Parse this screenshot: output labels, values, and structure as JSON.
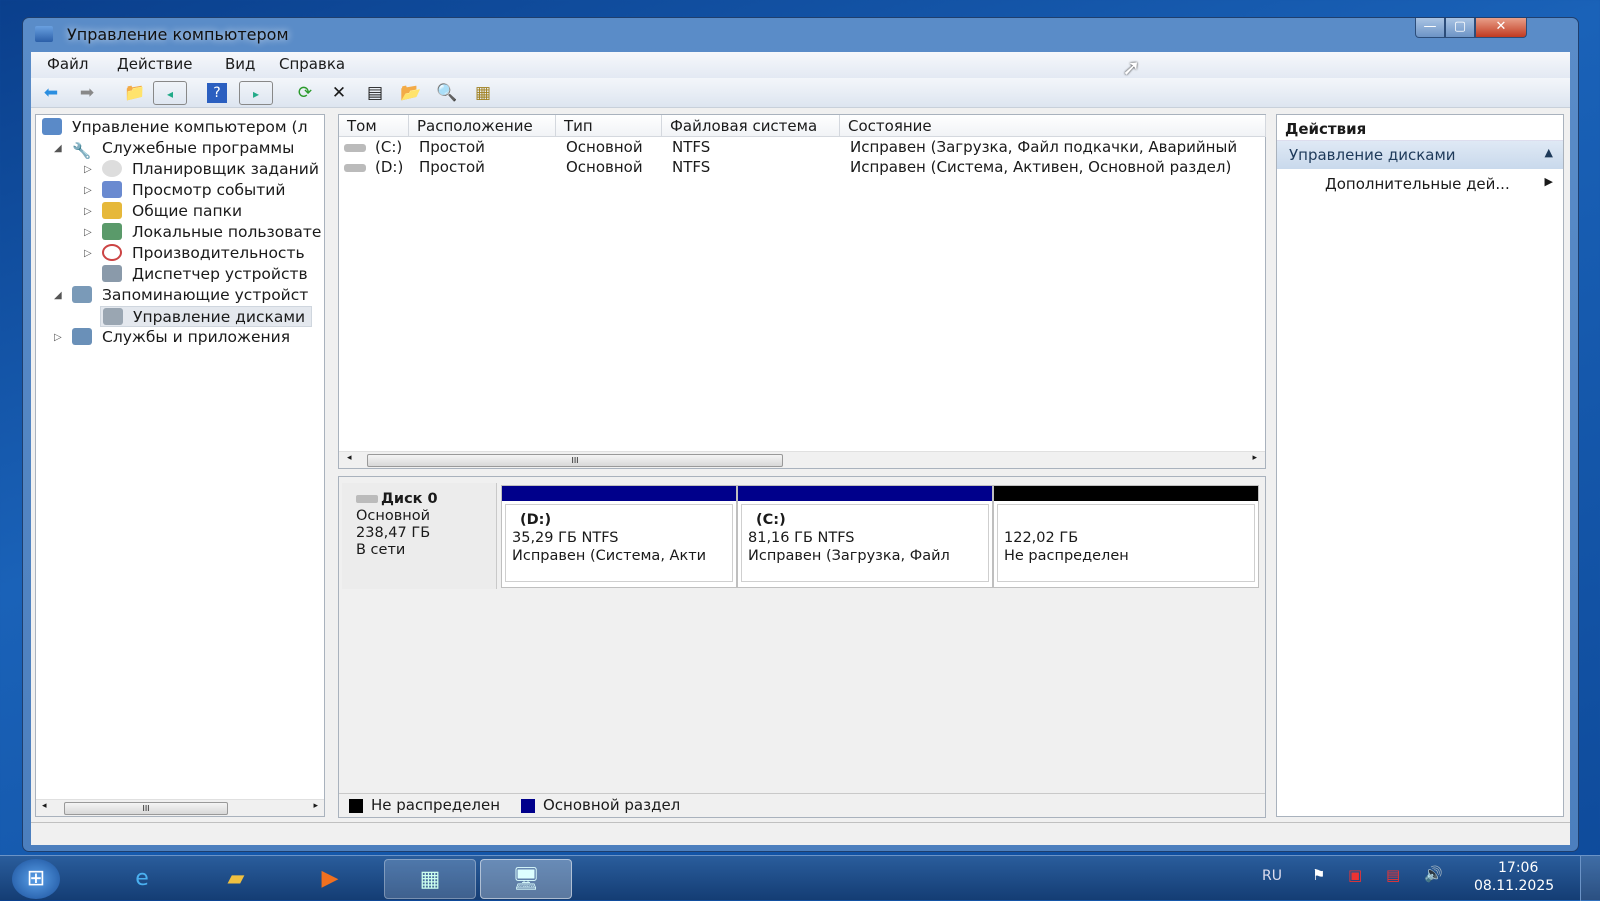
{
  "window": {
    "title": "Управление компьютером",
    "minimize": "—",
    "maximize": "▢",
    "close": "✕"
  },
  "menu": [
    "Файл",
    "Действие",
    "Вид",
    "Справка"
  ],
  "toolbar": [
    "back-icon",
    "forward-icon",
    "up-folder-icon",
    "show-hide-tree-icon",
    "help-icon",
    "show-hide-action-pane-icon",
    "refresh-icon",
    "delete-icon",
    "properties-icon",
    "open-icon",
    "search-icon",
    "settings-icon"
  ],
  "tree": {
    "root": "Управление компьютером (л",
    "items": [
      {
        "label": "Служебные программы",
        "expanded": true
      },
      {
        "label": "Планировщик заданий"
      },
      {
        "label": "Просмотр событий"
      },
      {
        "label": "Общие папки"
      },
      {
        "label": "Локальные пользовате"
      },
      {
        "label": "Производительность"
      },
      {
        "label": "Диспетчер устройств"
      },
      {
        "label": "Запоминающие устройст",
        "expanded": true
      },
      {
        "label": "Управление дисками",
        "selected": true
      },
      {
        "label": "Службы и приложения"
      }
    ],
    "scroll_thumb": "III"
  },
  "volumes": {
    "columns": [
      "Том",
      "Расположение",
      "Тип",
      "Файловая система",
      "Состояние"
    ],
    "rows": [
      {
        "volume": "(C:)",
        "layout": "Простой",
        "type": "Основной",
        "fs": "NTFS",
        "status": "Исправен (Загрузка, Файл подкачки, Аварийный"
      },
      {
        "volume": "(D:)",
        "layout": "Простой",
        "type": "Основной",
        "fs": "NTFS",
        "status": "Исправен (Система, Активен, Основной раздел)"
      }
    ],
    "scroll_thumb": "III"
  },
  "disk": {
    "name": "Диск 0",
    "type": "Основной",
    "size": "238,47 ГБ",
    "state": "В сети",
    "partitions": [
      {
        "label": "(D:)",
        "size": "35,29 ГБ NTFS",
        "status": "Исправен (Система, Акти",
        "color": "#00008b"
      },
      {
        "label": "(C:)",
        "size": "81,16 ГБ NTFS",
        "status": "Исправен (Загрузка, Файл",
        "color": "#00008b"
      },
      {
        "label": "",
        "size": "122,02 ГБ",
        "status": "Не распределен",
        "color": "#000000"
      }
    ]
  },
  "legend": [
    {
      "label": "Не распределен",
      "color": "#000000"
    },
    {
      "label": "Основной раздел",
      "color": "#00008b"
    }
  ],
  "actions": {
    "title": "Действия",
    "section": "Управление дисками",
    "more": "Дополнительные дей..."
  },
  "taskbar": {
    "lang": "RU",
    "time": "17:06",
    "date": "08.11.2025"
  }
}
